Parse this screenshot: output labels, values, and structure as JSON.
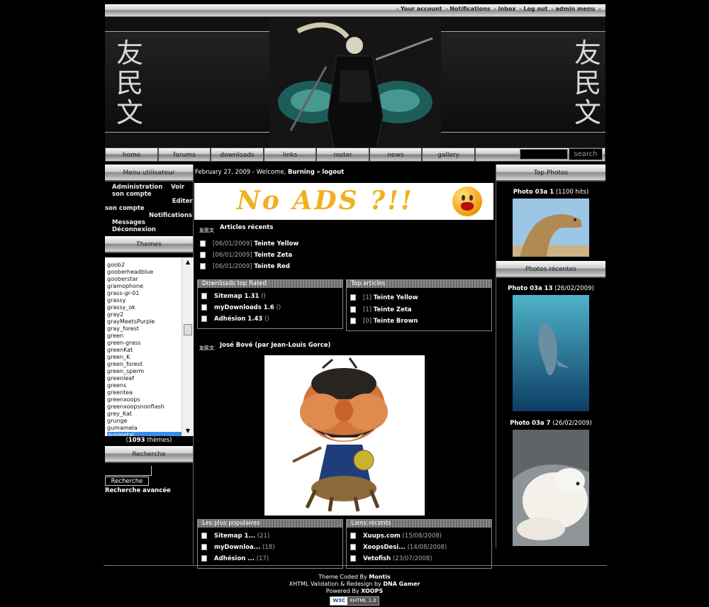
{
  "userbar": {
    "links": [
      "Your account",
      "Notifications",
      "Inbox",
      "Log out",
      "admin menu"
    ],
    "separator": "»"
  },
  "banner": {
    "kanji_left": [
      "友",
      "民",
      "文"
    ],
    "kanji_right": [
      "友",
      "民",
      "文"
    ]
  },
  "nav": {
    "tabs": [
      "home",
      "forums",
      "downloads",
      "links",
      "roster",
      "news",
      "gallery"
    ],
    "search_button": "search"
  },
  "left": {
    "usermenu_title": "Menu utilisateur",
    "usermenu_items": [
      "Administration",
      "Voir son compte",
      "Editer son compte",
      "Notifications",
      "Messages",
      "Déconnexion"
    ],
    "themes_title": "Themes",
    "themes": [
      "goob2",
      "gooberheadblue",
      "gooberstar",
      "gramophone",
      "grass-gr-01",
      "grassy",
      "grassy_ok",
      "gray2",
      "grayMeetsPurple",
      "gray_forest",
      "green",
      "green-grass",
      "greenKat",
      "green_K",
      "green_forest",
      "green_sperm",
      "greenleaf",
      "greens",
      "greentea",
      "greenxoops",
      "greenxoopsnonflash",
      "grey_Kat",
      "grunge",
      "gumamela",
      "gunmetal"
    ],
    "themes_selected": "gunmetal",
    "theme_count_num": "1093",
    "theme_count_label": "thèmes",
    "search_title": "Recherche",
    "search_button": "Recherche",
    "advanced_search": "Recherche avancée"
  },
  "center": {
    "welcome": {
      "date": "February 27, 2009",
      "prefix": "- Welcome,",
      "user": "Burning",
      "sep": "»",
      "logout": "logout"
    },
    "ad_text": "No ADS ?!!",
    "articles_title": "Articles récents",
    "logo_text": "友民文",
    "articles": [
      {
        "date": "[06/01/2009]",
        "title": "Teinte Yellow"
      },
      {
        "date": "[06/01/2009]",
        "title": "Teinte Zeta"
      },
      {
        "date": "[06/01/2009]",
        "title": "Teinte Red"
      }
    ],
    "downloads_title": "Downloads top Rated",
    "downloads": [
      {
        "title": "Sitemap 1.31",
        "extra": "()"
      },
      {
        "title": "myDownloads 1.6",
        "extra": "()"
      },
      {
        "title": "Adhésion 1.43",
        "extra": "()"
      }
    ],
    "toparticles_title": "Top articles",
    "toparticles": [
      {
        "count": "[1]",
        "title": "Teinte Yellow"
      },
      {
        "count": "[1]",
        "title": "Teinte Zeta"
      },
      {
        "count": "[0]",
        "title": "Teinte Brown"
      }
    ],
    "feature_title": "José Bové (par Jean-Louis Gorce)",
    "popular_title": "Les plus populaires",
    "popular": [
      {
        "title": "Sitemap 1...",
        "extra": "(21)"
      },
      {
        "title": "myDownloa...",
        "extra": "(18)"
      },
      {
        "title": "Adhésion ...",
        "extra": "(17)"
      }
    ],
    "links_title": "Liens récents",
    "links": [
      {
        "title": "Xuups.com",
        "extra": "(15/08/2008)"
      },
      {
        "title": "XoopsDesi...",
        "extra": "(14/08/2008)"
      },
      {
        "title": "Vetofish",
        "extra": "(23/07/2008)"
      }
    ]
  },
  "right": {
    "top_title": "Top Photos",
    "top_photo": {
      "name": "Photo 03a 1",
      "meta": "(1100 hits)"
    },
    "recent_title": "Photos récentes",
    "recent": [
      {
        "name": "Photo 03a 13",
        "meta": "(26/02/2009)"
      },
      {
        "name": "Photo 03a 7",
        "meta": "(26/02/2009)"
      }
    ]
  },
  "footer": {
    "line1_prefix": "Theme Coded By",
    "line1_name": "Montis",
    "line2_prefix": "XHTML Validation & Redesign by",
    "line2_name": "DNA Gamer",
    "line3_prefix": "Powered By",
    "line3_name": "XOOPS",
    "badge_w3": "W3C",
    "badge_text": "XHTML 1.0"
  }
}
